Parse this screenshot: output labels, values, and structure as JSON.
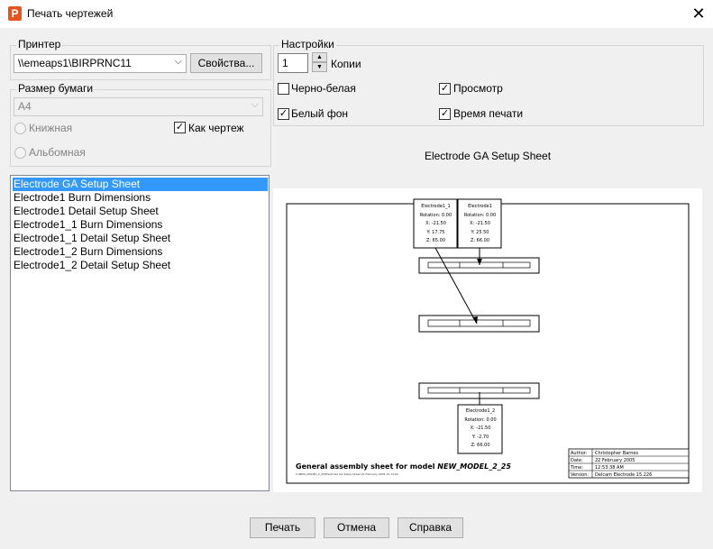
{
  "window": {
    "title": "Печать чертежей",
    "close_glyph": "✕",
    "app_icon_glyph": "P"
  },
  "printer": {
    "legend": "Принтер",
    "selected": "\\\\emeaps1\\BIRPRNC11",
    "properties_label": "Свойства..."
  },
  "paper": {
    "legend": "Размер бумаги",
    "size": "A4",
    "portrait_label": "Книжная",
    "landscape_label": "Альбомная",
    "as_drawing_label": "Как чертеж",
    "as_drawing_checked": true
  },
  "settings": {
    "legend": "Настройки",
    "copies_value": "1",
    "copies_label": "Копии",
    "bw_label": "Черно-белая",
    "bw_checked": false,
    "preview_label": "Просмотр",
    "preview_checked": true,
    "white_bg_label": "Белый фон",
    "white_bg_checked": true,
    "print_time_label": "Время печати",
    "print_time_checked": true
  },
  "drawings": {
    "items": [
      "Electrode GA Setup Sheet",
      "Electrode1 Burn Dimensions",
      "Electrode1 Detail Setup Sheet",
      "Electrode1_1 Burn Dimensions",
      "Electrode1_1 Detail Setup Sheet",
      "Electrode1_2 Burn Dimensions",
      "Electrode1_2 Detail Setup Sheet"
    ],
    "selected_index": 0
  },
  "preview": {
    "heading": "Electrode GA Setup Sheet",
    "boxes": [
      {
        "name": "Electrode1_1",
        "rotation": "Rotation: 0.00",
        "x": "X:   -21.50",
        "y": "Y:   17.75",
        "z": "Z:   65.00"
      },
      {
        "name": "Electrode1",
        "rotation": "Rotation: 0.00",
        "x": "X:   -21.50",
        "y": "Y:   25.50",
        "z": "Z:   66.00"
      },
      {
        "name": "Electrode1_2",
        "rotation": "Rotation: 0.00",
        "x": "X:   -21.50",
        "y": "Y:   -2.70",
        "z": "Z:   66.00"
      }
    ],
    "caption_prefix": "General assembly sheet for model ",
    "caption_model": "NEW_MODEL_2_25",
    "small_path": "V:\\NEW_MODEL_2_25\\Electrode GA Setup Sheet  22 February 2005  12:14:00",
    "title_block": [
      {
        "key": "Author:",
        "value": "Christopher Barnes"
      },
      {
        "key": "Date:",
        "value": "22 February 2005"
      },
      {
        "key": "Time:",
        "value": "12:53:38 AM"
      },
      {
        "key": "Version:",
        "value": "Delcam Electrode 15.226"
      }
    ]
  },
  "buttons": {
    "print": "Печать",
    "cancel": "Отмена",
    "help": "Справка"
  }
}
